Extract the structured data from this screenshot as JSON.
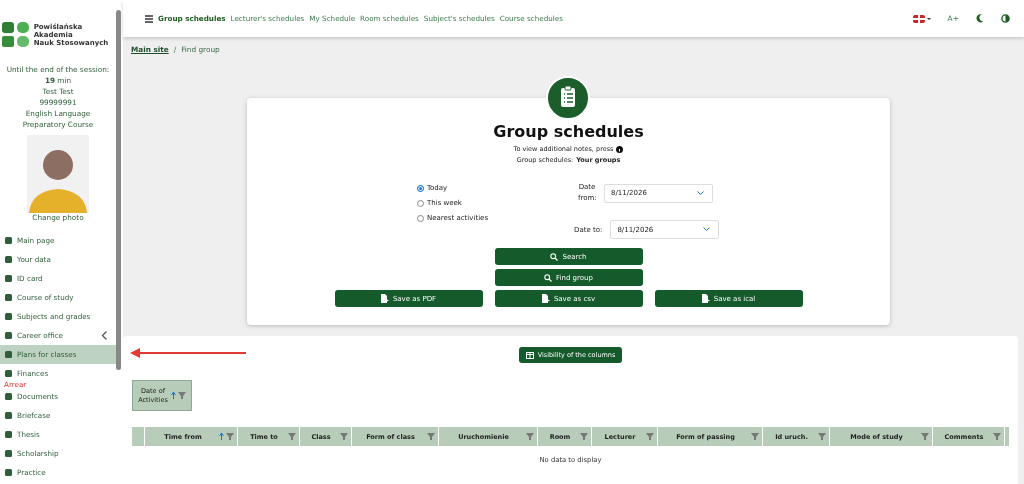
{
  "sidebar": {
    "logo_text": [
      "Powiślańska",
      "Akademia",
      "Nauk Stosowanych"
    ],
    "session_label": "Until the end of the session:",
    "session_value": "19",
    "session_unit": "min",
    "user_name": "Test Test",
    "user_id": "99999991",
    "course": "English Language Preparatory Course",
    "change_photo": "Change photo",
    "items": [
      {
        "label": "Main page",
        "selected": false
      },
      {
        "label": "Your data",
        "selected": false
      },
      {
        "label": "ID card",
        "selected": false
      },
      {
        "label": "Course of study",
        "selected": false
      },
      {
        "label": "Subjects and grades",
        "selected": false
      },
      {
        "label": "Career office",
        "selected": false,
        "expanded": false
      },
      {
        "label": "Plans for classes",
        "selected": true
      },
      {
        "label": "Finances",
        "selected": false,
        "note": "Arrear"
      },
      {
        "label": "Documents",
        "selected": false
      },
      {
        "label": "Briefcase",
        "selected": false
      },
      {
        "label": "Thesis",
        "selected": false
      },
      {
        "label": "Scholarship",
        "selected": false
      },
      {
        "label": "Practice",
        "selected": false
      }
    ]
  },
  "topbar": {
    "tabs": [
      {
        "label": "Group schedules",
        "selected": true
      },
      {
        "label": "Lecturer's schedules",
        "selected": false
      },
      {
        "label": "My Schedule",
        "selected": false
      },
      {
        "label": "Room schedules",
        "selected": false
      },
      {
        "label": "Subject's schedules",
        "selected": false
      },
      {
        "label": "Course schedules",
        "selected": false
      }
    ],
    "font_size_button": "A+"
  },
  "breadcrumb": {
    "items": [
      "Main site",
      "Find group"
    ],
    "separator": "/"
  },
  "card": {
    "title": "Group schedules",
    "hint": "To view additional notes, press",
    "info_line": "Group schedules: **Your groups**",
    "range_options": [
      {
        "label": "Today",
        "selected": true
      },
      {
        "label": "This week",
        "selected": false
      },
      {
        "label": "Nearest activities",
        "selected": false
      }
    ],
    "date_from": {
      "label": "Date from:",
      "value": "8/11/2026"
    },
    "date_to": {
      "label": "Date to:",
      "value": "8/11/2026"
    },
    "search_button": "Search",
    "find_button": "Find group",
    "save_buttons": [
      "Save as PDF",
      "Save as csv",
      "Save as ical"
    ]
  },
  "grid": {
    "columns_button": "Visibility of the columns",
    "group_panel": [
      {
        "label": "Date of Activities",
        "sorted": true
      }
    ],
    "columns": [
      {
        "label": "Time from",
        "sorted": true
      },
      {
        "label": "Time to",
        "sorted": false
      },
      {
        "label": "Class",
        "sorted": false
      },
      {
        "label": "Form of class",
        "sorted": false
      },
      {
        "label": "Uruchomienie",
        "sorted": false
      },
      {
        "label": "Room",
        "sorted": false
      },
      {
        "label": "Lecturer",
        "sorted": false
      },
      {
        "label": "Form of passing",
        "sorted": false
      },
      {
        "label": "Id uruch.",
        "sorted": false
      },
      {
        "label": "Mode of study",
        "sorted": false
      },
      {
        "label": "Comments",
        "sorted": false
      }
    ],
    "empty_text": "No data to display"
  }
}
